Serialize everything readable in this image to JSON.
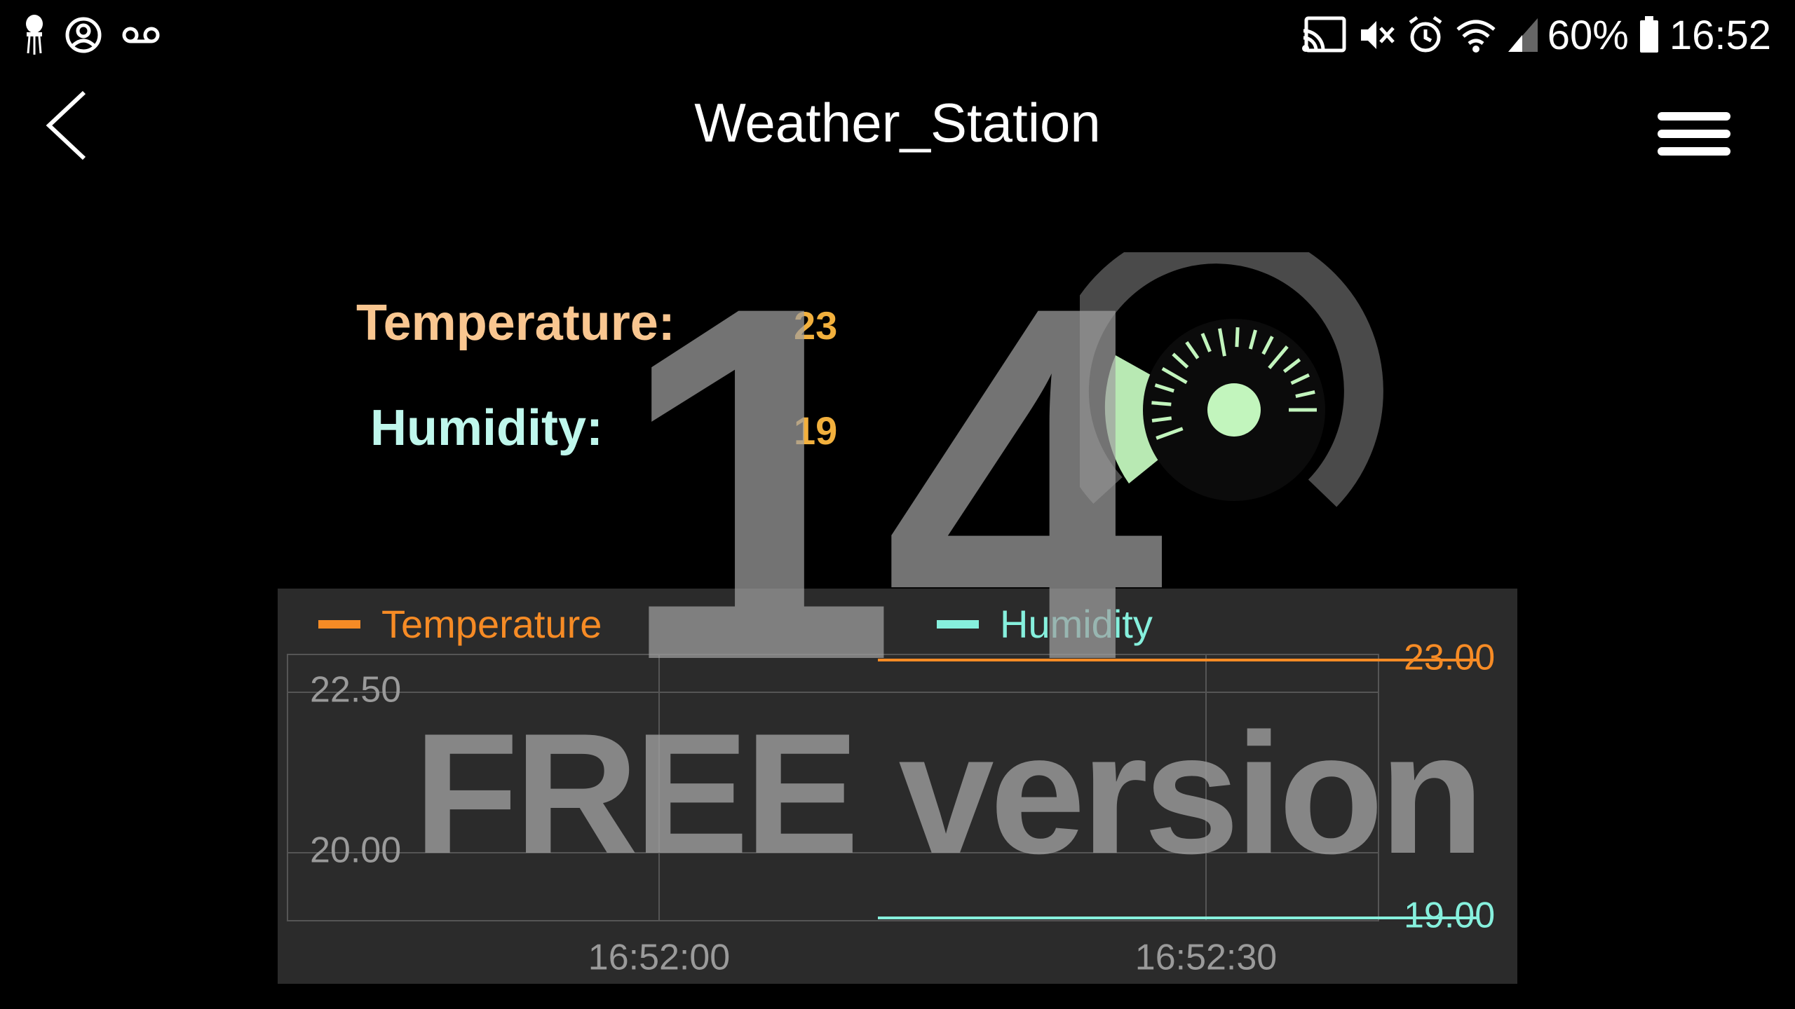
{
  "status_bar": {
    "battery_percent": "60%",
    "time": "16:52",
    "icons_left": [
      "jellyfish-icon",
      "account-circle-icon",
      "voicemail-icon"
    ],
    "icons_right": [
      "cast-icon",
      "mute-icon",
      "alarm-icon",
      "wifi-icon",
      "signal-icon",
      "battery-icon"
    ]
  },
  "app_bar": {
    "title": "Weather_Station"
  },
  "readings": {
    "temperature_label": "Temperature:",
    "temperature_value": "23",
    "humidity_label": "Humidity:",
    "humidity_value": "19"
  },
  "colors": {
    "temperature_label": "#f9c690",
    "humidity_label": "#bff7ec",
    "value": "#f2b03d",
    "temperature_series": "#f68b25",
    "humidity_series": "#86f0dd",
    "gauge_green": "#c2f5bd"
  },
  "chart_data": {
    "type": "line",
    "x": [
      "16:52:12",
      "16:52:45"
    ],
    "xticks": [
      "16:52:00",
      "16:52:30"
    ],
    "series": [
      {
        "name": "Temperature",
        "axis": "left",
        "values": [
          23,
          23
        ],
        "right_label": "23.00"
      },
      {
        "name": "Humidity",
        "axis": "right",
        "values": [
          19,
          19
        ],
        "right_label": "19.00"
      }
    ],
    "y_left_ticks": [
      "22.50",
      "20.00"
    ],
    "y_right_ticks": [
      "23.00",
      "19.00"
    ],
    "grid": true,
    "legend_position": "top"
  },
  "watermark": {
    "big_number": "14",
    "text": "FREE version"
  }
}
